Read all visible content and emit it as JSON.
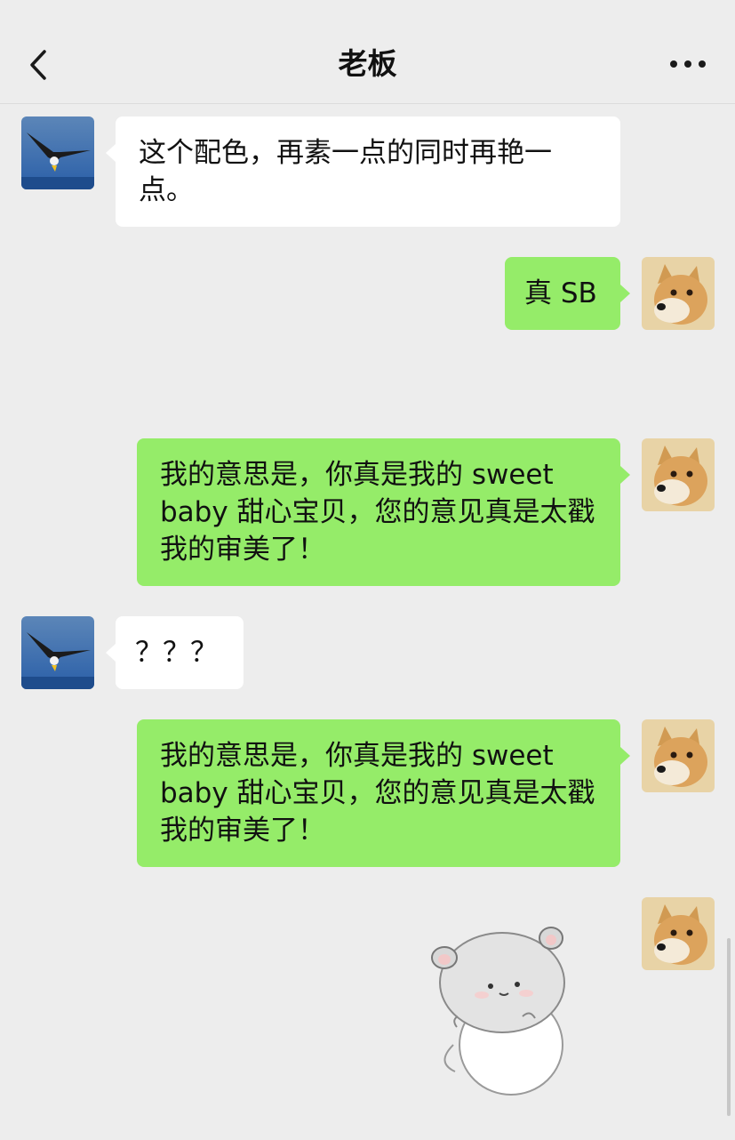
{
  "header": {
    "title": "老板",
    "back_icon": "chevron-left-icon",
    "more_icon": "more-dots-icon"
  },
  "colors": {
    "background": "#ededed",
    "incoming_bubble": "#ffffff",
    "outgoing_bubble": "#95ec69"
  },
  "messages": [
    {
      "sender": "boss",
      "avatar": "eagle-avatar",
      "text": "这个配色，再素一点的同时再艳一点。"
    },
    {
      "sender": "me",
      "avatar": "doge-avatar",
      "text": "真 SB"
    },
    {
      "sender": "me",
      "avatar": "doge-avatar",
      "text": "我的意思是，你真是我的 sweet baby 甜心宝贝，您的意见真是太戳我的审美了！"
    },
    {
      "sender": "boss",
      "avatar": "eagle-avatar",
      "text": "？？？"
    },
    {
      "sender": "me",
      "avatar": "doge-avatar",
      "text": "我的意思是，你真是我的 sweet baby 甜心宝贝，您的意见真是太戳我的审美了！"
    },
    {
      "sender": "me",
      "avatar": "doge-avatar",
      "type": "sticker",
      "sticker": "hamster-sticker"
    }
  ]
}
